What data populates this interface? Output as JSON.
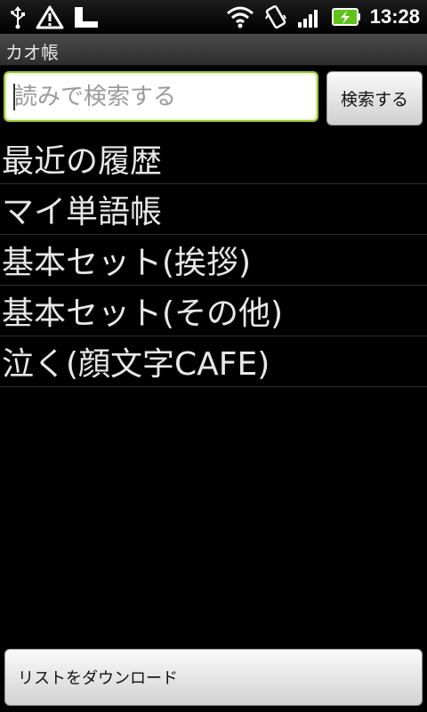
{
  "status_bar": {
    "time": "13:28",
    "icons_left": [
      "usb-icon",
      "warning-icon",
      "storage-icon"
    ],
    "icons_right": [
      "wifi-icon",
      "vibrate-icon",
      "signal-icon",
      "battery-icon"
    ]
  },
  "app": {
    "title": "カオ帳"
  },
  "search": {
    "value": "",
    "placeholder": "読みで検索する",
    "button_label": "検索する"
  },
  "list": {
    "items": [
      {
        "label": "最近の履歴"
      },
      {
        "label": "マイ単語帳"
      },
      {
        "label": "基本セット(挨拶)"
      },
      {
        "label": "基本セット(その他)"
      },
      {
        "label": "泣く(顔文字CAFE)"
      }
    ]
  },
  "footer": {
    "download_label": "リストをダウンロード"
  },
  "colors": {
    "background": "#000000",
    "focus_border": "#9cc43c",
    "battery_green": "#5fc31a",
    "list_text": "#e8e8e8"
  }
}
